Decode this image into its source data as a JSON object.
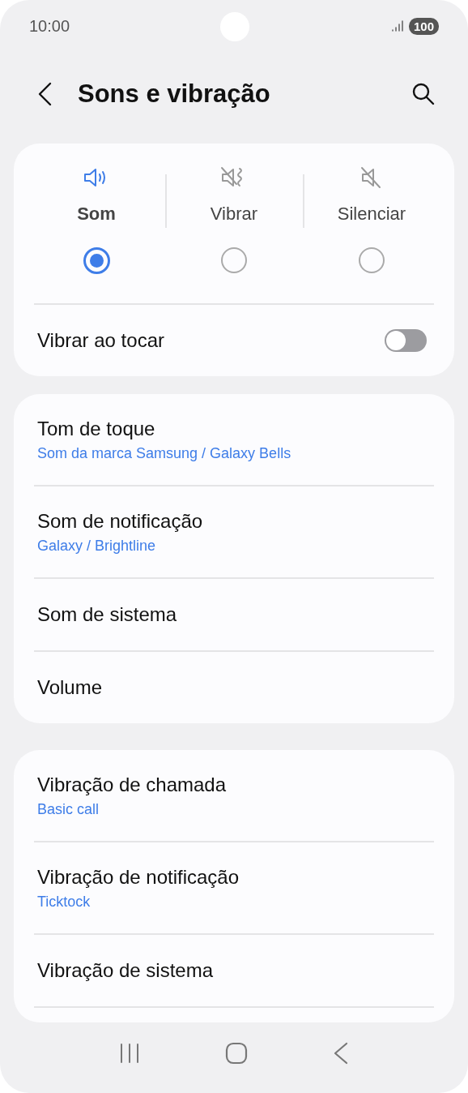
{
  "status_bar": {
    "time": "10:00",
    "battery": "100"
  },
  "header": {
    "title": "Sons e vibração"
  },
  "modes": [
    {
      "kind": "sound",
      "label": "Som",
      "selected": true
    },
    {
      "kind": "vibrate",
      "label": "Vibrar",
      "selected": false
    },
    {
      "kind": "mute",
      "label": "Silenciar",
      "selected": false
    }
  ],
  "vibrate_on_touch": {
    "label": "Vibrar ao tocar",
    "on": false
  },
  "sound_settings": [
    {
      "title": "Tom de toque",
      "subtitle": "Som da marca Samsung / Galaxy Bells"
    },
    {
      "title": "Som de notificação",
      "subtitle": "Galaxy / Brightline"
    },
    {
      "title": "Som de sistema"
    },
    {
      "title": "Volume"
    }
  ],
  "vibration_settings": [
    {
      "title": "Vibração de chamada",
      "subtitle": "Basic call"
    },
    {
      "title": "Vibração de notificação",
      "subtitle": "Ticktock"
    },
    {
      "title": "Vibração de sistema"
    }
  ]
}
